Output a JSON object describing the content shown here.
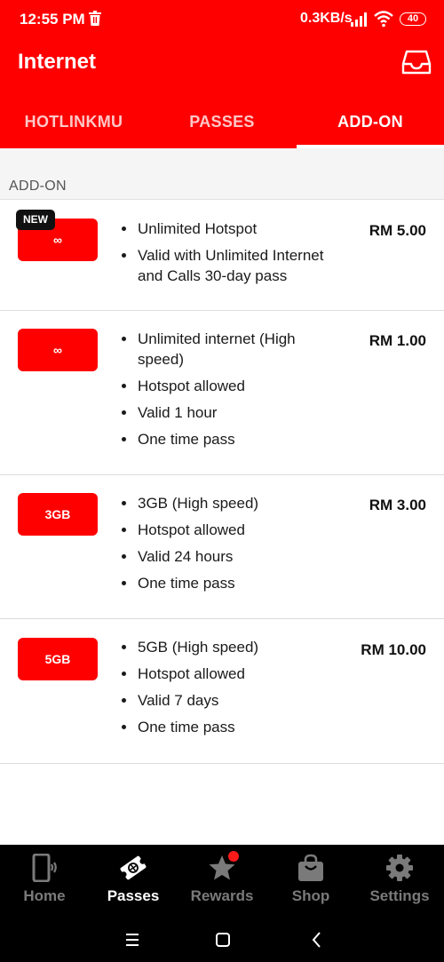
{
  "status_bar": {
    "time": "12:55 PM",
    "speed": "0.3KB/s",
    "battery": "40"
  },
  "header": {
    "title": "Internet"
  },
  "tabs": [
    {
      "label": "HOTLINKMU",
      "active": false
    },
    {
      "label": "PASSES",
      "active": false
    },
    {
      "label": "ADD-ON",
      "active": true
    }
  ],
  "section": {
    "label": "ADD-ON"
  },
  "offers": [
    {
      "tag": "NEW",
      "badge": "∞",
      "features": [
        "Unlimited Hotspot",
        "Valid with Unlimited Internet and Calls 30-day pass"
      ],
      "price": "RM 5.00"
    },
    {
      "badge": "∞",
      "features": [
        "Unlimited internet (High speed)",
        "Hotspot allowed",
        "Valid 1 hour",
        "One time pass"
      ],
      "price": "RM 1.00"
    },
    {
      "badge": "3GB",
      "features": [
        "3GB (High speed)",
        "Hotspot allowed",
        "Valid 24 hours",
        "One time pass"
      ],
      "price": "RM 3.00"
    },
    {
      "badge": "5GB",
      "features": [
        "5GB (High speed)",
        "Hotspot allowed",
        "Valid 7 days",
        "One time pass"
      ],
      "price": "RM 10.00"
    }
  ],
  "bottom_nav": [
    {
      "label": "Home",
      "icon": "phone-icon",
      "active": false
    },
    {
      "label": "Passes",
      "icon": "ticket-icon",
      "active": true
    },
    {
      "label": "Rewards",
      "icon": "star-icon",
      "active": false
    },
    {
      "label": "Shop",
      "icon": "shopping-bag-icon",
      "active": false
    },
    {
      "label": "Settings",
      "icon": "gear-icon",
      "active": false
    }
  ],
  "colors": {
    "brand": "#ff0000",
    "nav_bg": "#000000",
    "notification_dot": "#ff1a1a"
  }
}
